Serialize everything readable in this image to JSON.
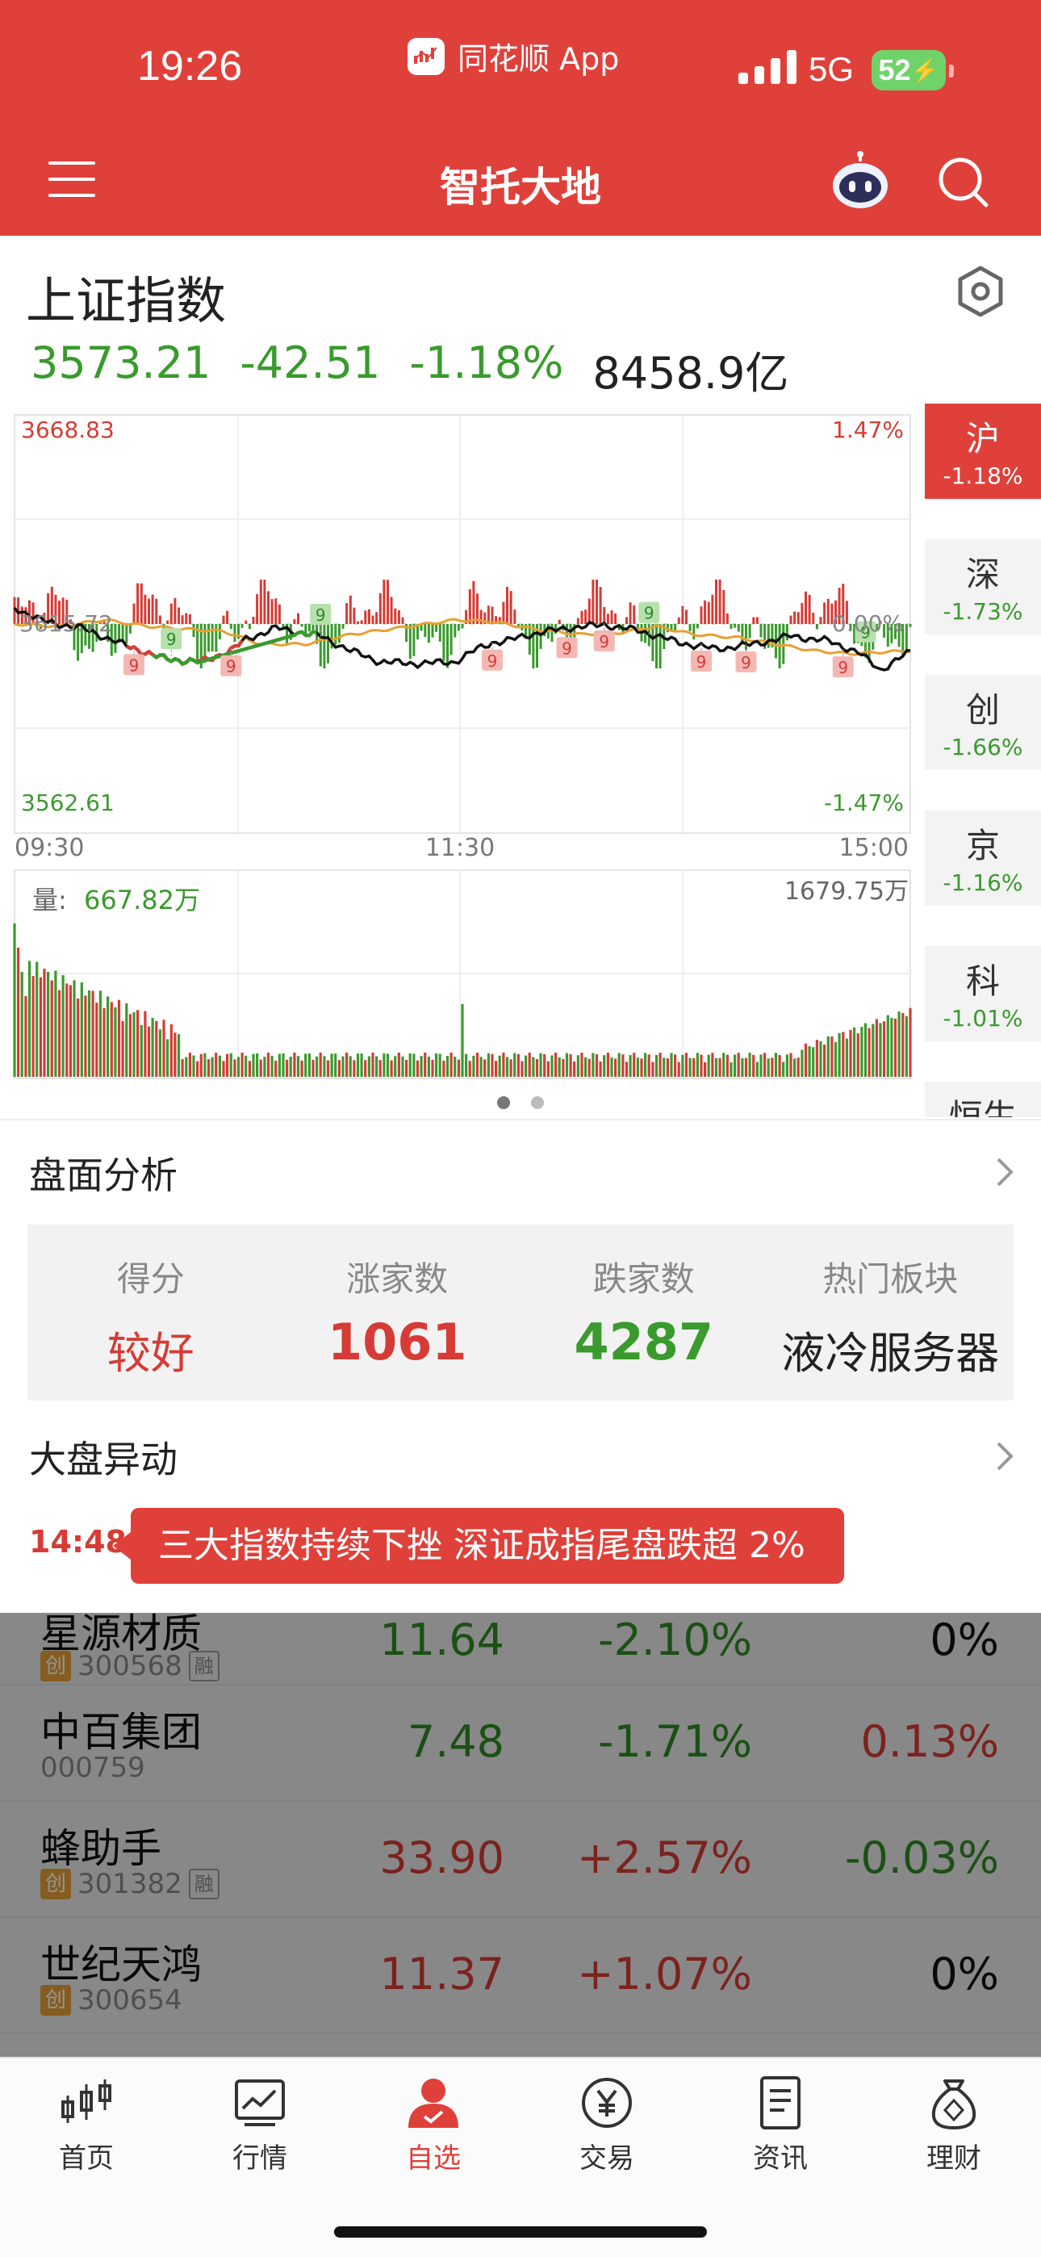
{
  "status_bar": {
    "time": "19:26",
    "source_app": "同花顺 App",
    "network": "5G",
    "battery": "52"
  },
  "header": {
    "title": "智托大地"
  },
  "index": {
    "name": "上证指数",
    "last": "3573.21",
    "change": "-42.51",
    "change_pct": "-1.18%",
    "turnover": "8458.9亿"
  },
  "intraday_chart": {
    "price_high_label": "3668.83",
    "price_ref_label": "3615.72",
    "price_low_label": "3562.61",
    "pct_high_label": "1.47%",
    "pct_ref_label": "0.00%",
    "pct_low_label": "-1.47%",
    "time_start": "09:30",
    "time_mid": "11:30",
    "time_end": "15:00",
    "volume_label": "量:",
    "volume_value": "667.82万",
    "volume_max_label": "1679.75万",
    "nine_markers": [
      "9",
      "9",
      "9",
      "9",
      "9",
      "9",
      "9",
      "9",
      "9",
      "9",
      "9",
      "9"
    ]
  },
  "index_tabs": [
    {
      "name": "沪",
      "pct": "-1.18%",
      "active": true
    },
    {
      "name": "深",
      "pct": "-1.73%",
      "active": false
    },
    {
      "name": "创",
      "pct": "-1.66%",
      "active": false
    },
    {
      "name": "京",
      "pct": "-1.16%",
      "active": false
    },
    {
      "name": "科",
      "pct": "-1.01%",
      "active": false
    },
    {
      "name": "恒生",
      "pct": "",
      "active": false
    }
  ],
  "analysis": {
    "title": "盘面分析",
    "score_label": "得分",
    "score_value": "较好",
    "up_label": "涨家数",
    "up_value": "1061",
    "down_label": "跌家数",
    "down_value": "4287",
    "hot_label": "热门板块",
    "hot_value": "液冷服务器"
  },
  "movement": {
    "title": "大盘异动",
    "time": "14:48",
    "message": "三大指数持续下挫 深证成指尾盘跌超 2%"
  },
  "watchlist": [
    {
      "name": "星源材质",
      "code": "300568",
      "cy_tag": "创",
      "rong_tag": "融",
      "price": "11.64",
      "change": "-2.10%",
      "extra": "0%"
    },
    {
      "name": "中百集团",
      "code": "000759",
      "cy_tag": "",
      "rong_tag": "",
      "price": "7.48",
      "change": "-1.71%",
      "extra": "0.13%"
    },
    {
      "name": "蜂助手",
      "code": "301382",
      "cy_tag": "创",
      "rong_tag": "融",
      "price": "33.90",
      "change": "+2.57%",
      "extra": "-0.03%"
    },
    {
      "name": "世纪天鸿",
      "code": "300654",
      "cy_tag": "创",
      "rong_tag": "",
      "price": "11.37",
      "change": "+1.07%",
      "extra": "0%"
    }
  ],
  "bottom_nav": [
    {
      "label": "首页",
      "icon": "candlestick-icon",
      "active": false
    },
    {
      "label": "行情",
      "icon": "chart-icon",
      "active": false
    },
    {
      "label": "自选",
      "icon": "person-icon",
      "active": true
    },
    {
      "label": "交易",
      "icon": "yen-icon",
      "active": false
    },
    {
      "label": "资讯",
      "icon": "document-icon",
      "active": false
    },
    {
      "label": "理财",
      "icon": "moneybag-icon",
      "active": false
    }
  ],
  "colors": {
    "brand_red": "#e0403a",
    "up_red": "#d63b35",
    "down_green": "#3a9a2d",
    "avg_line": "#e8a030"
  }
}
